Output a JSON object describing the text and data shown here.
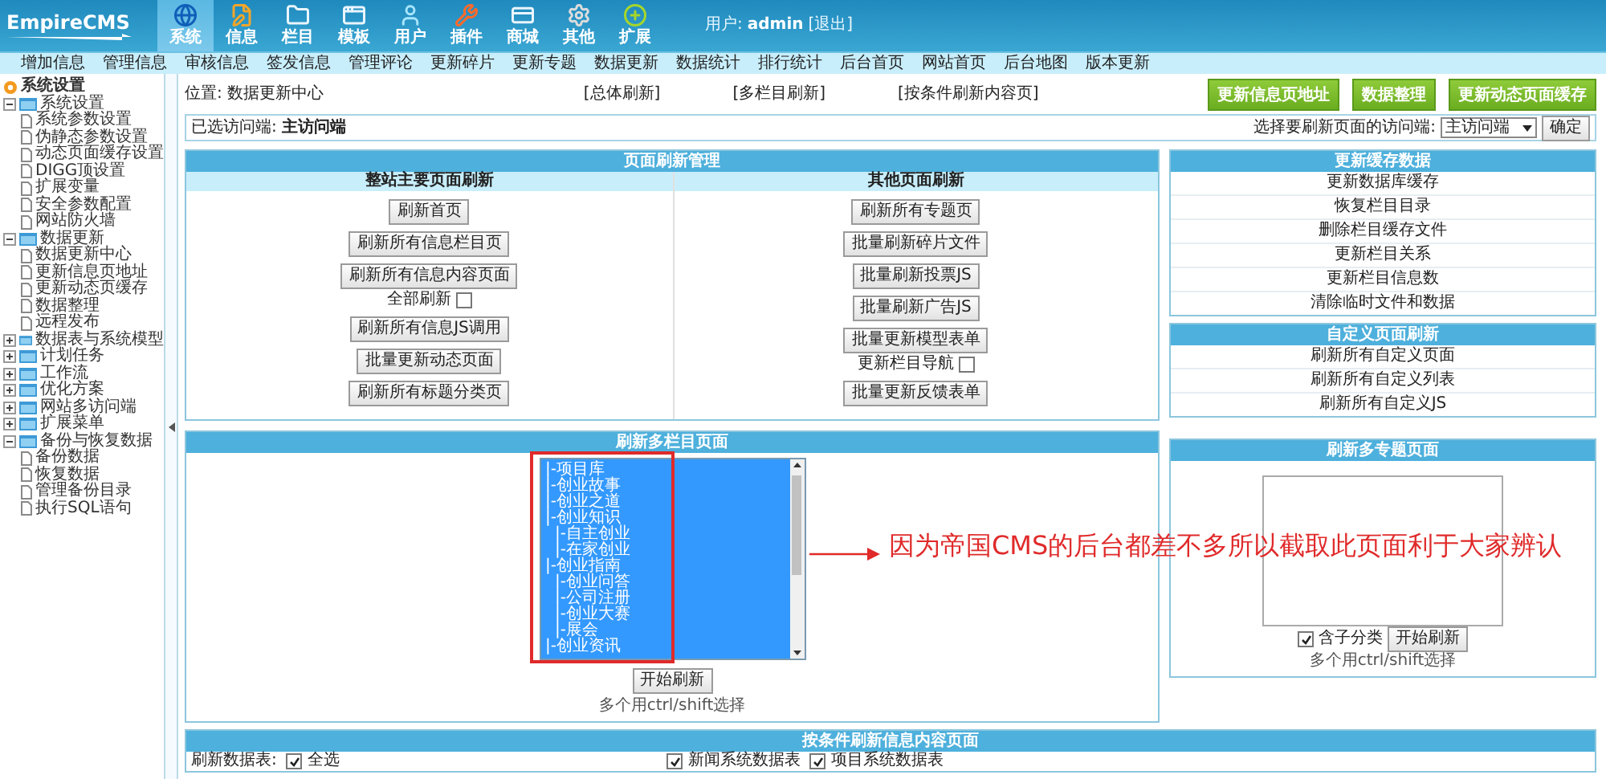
{
  "header": {
    "logo": "EmpireCMS",
    "modules": [
      {
        "label": "系统",
        "selected": true
      },
      {
        "label": "信息",
        "selected": false
      },
      {
        "label": "栏目",
        "selected": false
      },
      {
        "label": "模板",
        "selected": false
      },
      {
        "label": "用户",
        "selected": false
      },
      {
        "label": "插件",
        "selected": false
      },
      {
        "label": "商城",
        "selected": false
      },
      {
        "label": "其他",
        "selected": false
      },
      {
        "label": "扩展",
        "selected": false
      }
    ],
    "user_label": "用户:",
    "user": "admin",
    "logout": "[退出]"
  },
  "nav": [
    "增加信息",
    "管理信息",
    "审核信息",
    "签发信息",
    "管理评论",
    "更新碎片",
    "更新专题",
    "数据更新",
    "数据统计",
    "排行统计",
    "后台首页",
    "网站首页",
    "后台地图",
    "版本更新"
  ],
  "sidebar": {
    "title": "系统设置",
    "items": [
      {
        "label": "系统设置",
        "expanded": true,
        "children": [
          {
            "label": "系统参数设置"
          },
          {
            "label": "伪静态参数设置"
          },
          {
            "label": "动态页面缓存设置"
          },
          {
            "label": "DIGG顶设置"
          },
          {
            "label": "扩展变量"
          },
          {
            "label": "安全参数配置"
          },
          {
            "label": "网站防火墙"
          }
        ]
      },
      {
        "label": "数据更新",
        "expanded": true,
        "children": [
          {
            "label": "数据更新中心"
          },
          {
            "label": "更新信息页地址"
          },
          {
            "label": "更新动态页缓存"
          },
          {
            "label": "数据整理"
          },
          {
            "label": "远程发布"
          }
        ]
      },
      {
        "label": "数据表与系统模型",
        "expanded": false
      },
      {
        "label": "计划任务",
        "expanded": false
      },
      {
        "label": "工作流",
        "expanded": false
      },
      {
        "label": "优化方案",
        "expanded": false
      },
      {
        "label": "网站多访问端",
        "expanded": false
      },
      {
        "label": "扩展菜单",
        "expanded": false
      },
      {
        "label": "备份与恢复数据",
        "expanded": true,
        "children": [
          {
            "label": "备份数据"
          },
          {
            "label": "恢复数据"
          },
          {
            "label": "管理备份目录"
          },
          {
            "label": "执行SQL语句"
          }
        ]
      }
    ]
  },
  "location": {
    "label": "位置:",
    "page": "数据更新中心",
    "links": [
      "[总体刷新]",
      "[多栏目刷新]",
      "[按条件刷新内容页]"
    ],
    "buttons": [
      "更新信息页地址",
      "数据整理",
      "更新动态页面缓存"
    ]
  },
  "access": {
    "label": "已选访问端:",
    "value": "主访问端",
    "select_label": "选择要刷新页面的访问端:",
    "select_value": "主访问端",
    "confirm": "确定"
  },
  "refresh_panel": {
    "title": "页面刷新管理",
    "columns": [
      {
        "heading": "整站主要页面刷新",
        "items": [
          {
            "kind": "button",
            "label": "刷新首页"
          },
          {
            "kind": "button",
            "label": "刷新所有信息栏目页"
          },
          {
            "kind": "button",
            "label": "刷新所有信息内容页面"
          },
          {
            "kind": "checkbox",
            "label": "全部刷新",
            "checked": false
          },
          {
            "kind": "button",
            "label": "刷新所有信息JS调用"
          },
          {
            "kind": "button",
            "label": "批量更新动态页面"
          },
          {
            "kind": "button",
            "label": "刷新所有标题分类页"
          }
        ]
      },
      {
        "heading": "其他页面刷新",
        "items": [
          {
            "kind": "button",
            "label": "刷新所有专题页"
          },
          {
            "kind": "button",
            "label": "批量刷新碎片文件"
          },
          {
            "kind": "button",
            "label": "批量刷新投票JS"
          },
          {
            "kind": "button",
            "label": "批量刷新广告JS"
          },
          {
            "kind": "button",
            "label": "批量更新模型表单"
          },
          {
            "kind": "checkbox",
            "label": "更新栏目导航",
            "checked": false
          },
          {
            "kind": "button",
            "label": "批量更新反馈表单"
          }
        ]
      }
    ]
  },
  "cache_panel": {
    "title": "更新缓存数据",
    "links": [
      "更新数据库缓存",
      "恢复栏目目录",
      "删除栏目缓存文件",
      "更新栏目关系",
      "更新栏目信息数",
      "清除临时文件和数据"
    ]
  },
  "custom_panel": {
    "title": "自定义页面刷新",
    "links": [
      "刷新所有自定义页面",
      "刷新所有自定义列表",
      "刷新所有自定义JS"
    ]
  },
  "multi_column": {
    "title": "刷新多栏目页面",
    "options": [
      {
        "label": "|-项目库",
        "selected": true
      },
      {
        "label": "|-创业故事",
        "selected": true
      },
      {
        "label": "|-创业之道",
        "selected": true
      },
      {
        "label": "|-创业知识",
        "selected": true,
        "children": [
          {
            "label": "|-自主创业",
            "selected": true
          },
          {
            "label": "|-在家创业",
            "selected": true
          }
        ]
      },
      {
        "label": "|-创业指南",
        "selected": true,
        "children": [
          {
            "label": "|-创业问答",
            "selected": true
          },
          {
            "label": "|-公司注册",
            "selected": true
          },
          {
            "label": "|-创业大赛",
            "selected": true
          },
          {
            "label": "|-展会",
            "selected": true
          }
        ]
      },
      {
        "label": "|-创业资讯",
        "selected": true
      }
    ],
    "button": "开始刷新",
    "hint": "多个用ctrl/shift选择"
  },
  "multi_topic": {
    "title": "刷新多专题页面",
    "include_label": "含子分类",
    "include_checked": true,
    "button": "开始刷新",
    "hint": "多个用ctrl/shift选择"
  },
  "conditional": {
    "title": "按条件刷新信息内容页面",
    "label": "刷新数据表:",
    "tables": [
      {
        "label": "全选",
        "checked": true
      },
      {
        "label": "新闻系统数据表",
        "checked": true
      },
      {
        "label": "项目系统数据表",
        "checked": true
      }
    ]
  },
  "annotation": {
    "text": "因为帝国CMS的后台都差不多所以截取此页面利于大家辨认"
  }
}
